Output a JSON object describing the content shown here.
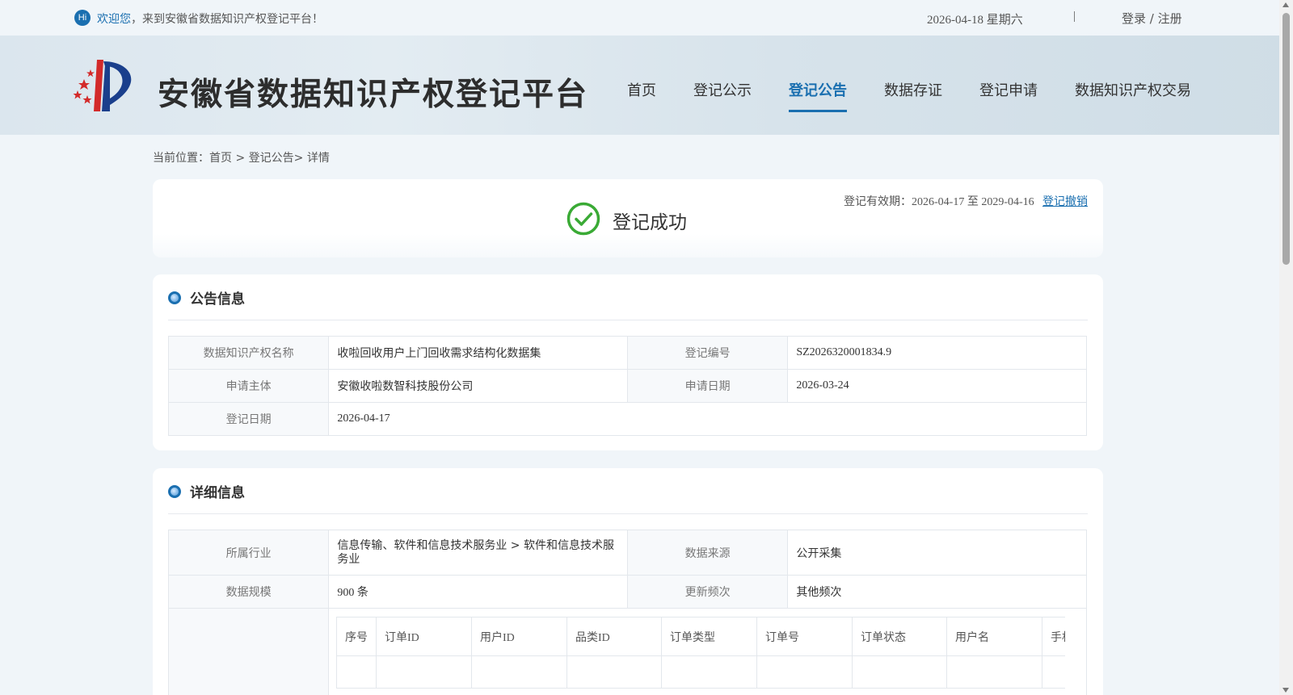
{
  "topbar": {
    "hi_badge": "Hi",
    "welcome_highlight": "欢迎您",
    "welcome_rest": "，来到安徽省数据知识产权登记平台！",
    "date": "2026-04-18 星期六",
    "separator": "|",
    "login_register": "登录 / 注册"
  },
  "header": {
    "site_title": "安徽省数据知识产权登记平台",
    "nav": [
      {
        "label": "首页",
        "active": false
      },
      {
        "label": "登记公示",
        "active": false
      },
      {
        "label": "登记公告",
        "active": true
      },
      {
        "label": "数据存证",
        "active": false
      },
      {
        "label": "登记申请",
        "active": false
      },
      {
        "label": "数据知识产权交易",
        "active": false
      }
    ]
  },
  "breadcrumb": {
    "prefix": "当前位置：",
    "home": "首页",
    "sep1": " > ",
    "section": "登记公告",
    "sep2": "> ",
    "current": "详情"
  },
  "status": {
    "text": "登记成功",
    "validity": "登记有效期：2026-04-17 至 2029-04-16",
    "revoke_link": "登记撤销"
  },
  "announcement": {
    "title": "公告信息",
    "rows": [
      [
        {
          "label": "数据知识产权名称",
          "value": "收啦回收用户上门回收需求结构化数据集"
        },
        {
          "label": "登记编号",
          "value": "SZ2026320001834.9"
        }
      ],
      [
        {
          "label": "申请主体",
          "value": "安徽收啦数智科技股份公司"
        },
        {
          "label": "申请日期",
          "value": "2026-03-24"
        }
      ],
      [
        {
          "label": "登记日期",
          "value": "2026-04-17"
        }
      ]
    ]
  },
  "detail": {
    "title": "详细信息",
    "rows": [
      [
        {
          "label": "所属行业",
          "value": "信息传输、软件和信息技术服务业 > 软件和信息技术服务业"
        },
        {
          "label": "数据来源",
          "value": "公开采集"
        }
      ],
      [
        {
          "label": "数据规模",
          "value": "900 条"
        },
        {
          "label": "更新频次",
          "value": "其他频次"
        }
      ]
    ],
    "sample_table": {
      "columns": [
        "序号",
        "订单ID",
        "用户ID",
        "品类ID",
        "订单类型",
        "订单号",
        "订单状态",
        "用户名",
        "手机"
      ]
    }
  },
  "colors": {
    "accent": "#1a6fb0",
    "success": "#3aaa35",
    "page_bg": "#f0f5f9"
  }
}
